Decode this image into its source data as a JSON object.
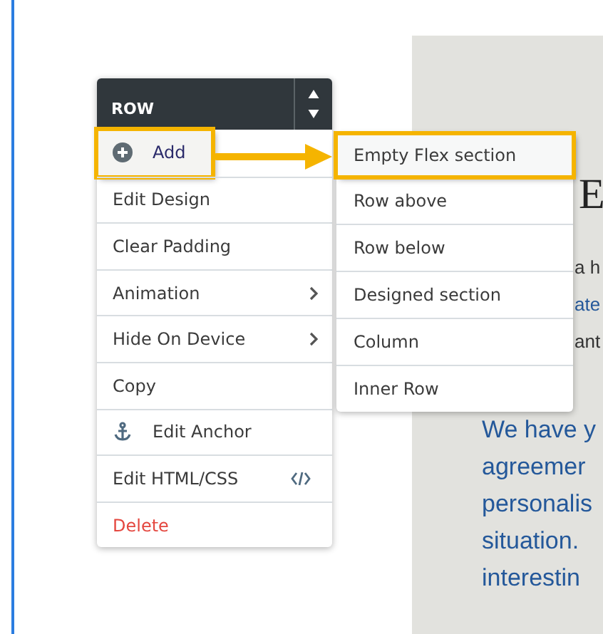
{
  "menu": {
    "title": "ROW",
    "items": [
      {
        "label": "Add",
        "kind": "add",
        "highlighted": true
      },
      {
        "label": "Edit Design",
        "kind": "plain",
        "highlighted": false
      },
      {
        "label": "Clear Padding",
        "kind": "plain",
        "highlighted": false
      },
      {
        "label": "Animation",
        "kind": "submenu",
        "highlighted": false
      },
      {
        "label": "Hide On Device",
        "kind": "submenu",
        "highlighted": false
      },
      {
        "label": "Copy",
        "kind": "plain",
        "highlighted": false
      },
      {
        "label": "Edit Anchor",
        "kind": "anchor",
        "highlighted": false
      },
      {
        "label": "Edit HTML/CSS",
        "kind": "code",
        "highlighted": false
      },
      {
        "label": "Delete",
        "kind": "danger",
        "highlighted": false
      }
    ]
  },
  "submenu": {
    "items": [
      {
        "label": "Empty Flex section",
        "highlighted": true
      },
      {
        "label": "Row above",
        "highlighted": false
      },
      {
        "label": "Row below",
        "highlighted": false
      },
      {
        "label": "Designed section",
        "highlighted": false
      },
      {
        "label": "Column",
        "highlighted": false
      },
      {
        "label": "Inner Row",
        "highlighted": false
      }
    ]
  },
  "page": {
    "heading": "E",
    "intro_lines": [
      "a h",
      "ate",
      "ant"
    ],
    "paragraph_lines": [
      "We have y",
      "agreemer",
      "personalis",
      "situation.",
      "interestin"
    ]
  }
}
